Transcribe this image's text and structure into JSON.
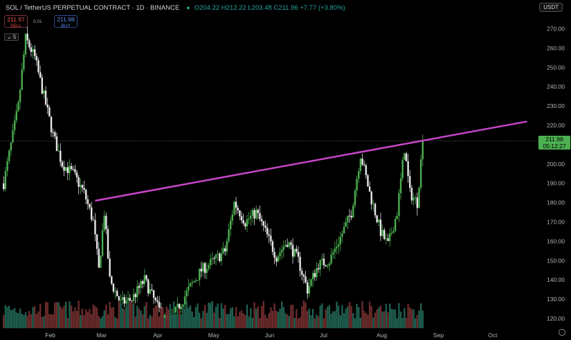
{
  "header": {
    "symbol": "SOL / TetherUS PERPETUAL CONTRACT · 1D · BINANCE",
    "live_icon": "dot-icon",
    "ohlc": "O204.22 H212.22 L203.48 C211.96 +7.77 (+3.80%)",
    "currency": "USDT"
  },
  "order": {
    "sell_price": "211.97",
    "sell_label": "SELL",
    "spread": "0.01",
    "buy_price": "211.98",
    "buy_label": "BUY"
  },
  "collapse_label": "⌄ 5",
  "price_badge": {
    "price": "211.98",
    "countdown": "05:12:27"
  },
  "colors": {
    "up": "#4caf50",
    "down": "#e8e8e8",
    "trendline": "#c846c8",
    "volume_up": "#1e5e4e",
    "volume_down": "#6b2b2b"
  },
  "chart_data": {
    "type": "candlestick",
    "y_ticks": [
      270,
      260,
      250,
      240,
      230,
      220,
      210,
      200,
      190,
      180,
      170,
      160,
      150,
      140,
      130,
      120
    ],
    "ylim": [
      115,
      277
    ],
    "x_labels": [
      "Feb",
      "Mar",
      "Apr",
      "May",
      "Jun",
      "Jul",
      "Aug",
      "Sep",
      "Oct"
    ],
    "last_price": 211.98,
    "trendline": {
      "start": [
        "2025-02-26",
        181
      ],
      "end": [
        "2025-10-20",
        222
      ]
    },
    "close_path": [
      [
        "2025-01-07",
        190
      ],
      [
        "2025-01-10",
        205
      ],
      [
        "2025-01-15",
        230
      ],
      [
        "2025-01-19",
        265
      ],
      [
        "2025-01-24",
        255
      ],
      [
        "2025-01-29",
        235
      ],
      [
        "2025-02-03",
        215
      ],
      [
        "2025-02-08",
        200
      ],
      [
        "2025-02-14",
        195
      ],
      [
        "2025-02-20",
        185
      ],
      [
        "2025-02-25",
        170
      ],
      [
        "2025-02-28",
        145
      ],
      [
        "2025-03-03",
        175
      ],
      [
        "2025-03-06",
        140
      ],
      [
        "2025-03-12",
        128
      ],
      [
        "2025-03-18",
        130
      ],
      [
        "2025-03-25",
        140
      ],
      [
        "2025-04-01",
        126
      ],
      [
        "2025-04-07",
        117
      ],
      [
        "2025-04-12",
        125
      ],
      [
        "2025-04-18",
        135
      ],
      [
        "2025-04-25",
        145
      ],
      [
        "2025-05-02",
        150
      ],
      [
        "2025-05-08",
        155
      ],
      [
        "2025-05-13",
        180
      ],
      [
        "2025-05-19",
        170
      ],
      [
        "2025-05-25",
        175
      ],
      [
        "2025-05-30",
        165
      ],
      [
        "2025-06-05",
        152
      ],
      [
        "2025-06-11",
        160
      ],
      [
        "2025-06-17",
        150
      ],
      [
        "2025-06-22",
        135
      ],
      [
        "2025-06-28",
        148
      ],
      [
        "2025-07-04",
        150
      ],
      [
        "2025-07-10",
        162
      ],
      [
        "2025-07-16",
        175
      ],
      [
        "2025-07-21",
        205
      ],
      [
        "2025-07-26",
        185
      ],
      [
        "2025-08-01",
        165
      ],
      [
        "2025-08-05",
        158
      ],
      [
        "2025-08-10",
        175
      ],
      [
        "2025-08-14",
        208
      ],
      [
        "2025-08-17",
        185
      ],
      [
        "2025-08-21",
        180
      ],
      [
        "2025-08-24",
        212
      ]
    ],
    "date_range": [
      "2025-01-05",
      "2025-10-27"
    ]
  }
}
